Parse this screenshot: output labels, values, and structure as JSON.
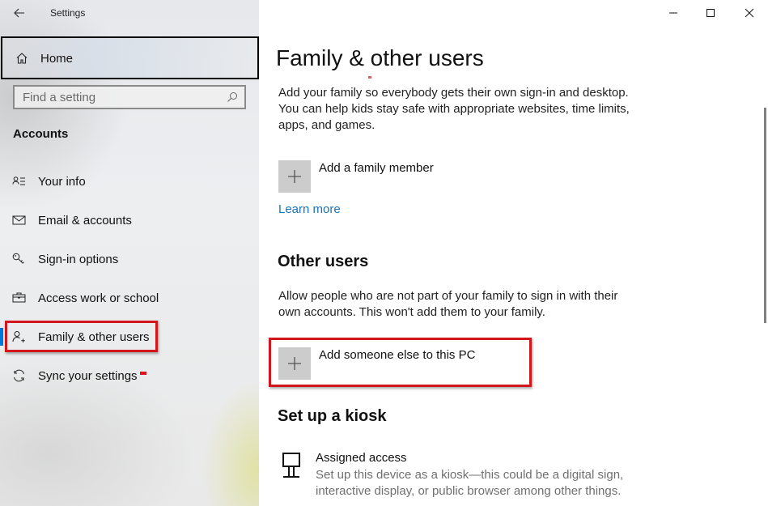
{
  "window": {
    "title": "Settings",
    "controls": {
      "minimize": "minimize-icon",
      "maximize": "maximize-icon",
      "close": "close-icon"
    }
  },
  "sidebar": {
    "back_icon": "back-arrow-icon",
    "home": {
      "label": "Home",
      "icon": "home-icon"
    },
    "search": {
      "placeholder": "Find a setting",
      "value": "",
      "icon": "search-icon"
    },
    "section": "Accounts",
    "items": [
      {
        "label": "Your info",
        "icon": "person-card-icon",
        "selected": false
      },
      {
        "label": "Email & accounts",
        "icon": "mail-icon",
        "selected": false
      },
      {
        "label": "Sign-in options",
        "icon": "key-icon",
        "selected": false
      },
      {
        "label": "Access work or school",
        "icon": "briefcase-icon",
        "selected": false
      },
      {
        "label": "Family & other users",
        "icon": "person-add-icon",
        "selected": true
      },
      {
        "label": "Sync your settings",
        "icon": "sync-icon",
        "selected": false
      }
    ],
    "accent_color": "#0078d7",
    "annotation_color": "#d3151c"
  },
  "main": {
    "title": "Family & other users",
    "family": {
      "description": "Add your family so everybody gets their own sign-in and desktop. You can help kids stay safe with appropriate websites, time limits, apps, and games.",
      "add_label": "Add a family member",
      "learn_more": "Learn more"
    },
    "other_users": {
      "heading": "Other users",
      "description": "Allow people who are not part of your family to sign in with their own accounts. This won't add them to your family.",
      "add_label": "Add someone else to this PC"
    },
    "kiosk": {
      "heading": "Set up a kiosk",
      "item_title": "Assigned access",
      "item_description": "Set up this device as a kiosk—this could be a digital sign, interactive display, or public browser among other things.",
      "icon": "kiosk-icon"
    },
    "link_color": "#1a73b8"
  }
}
